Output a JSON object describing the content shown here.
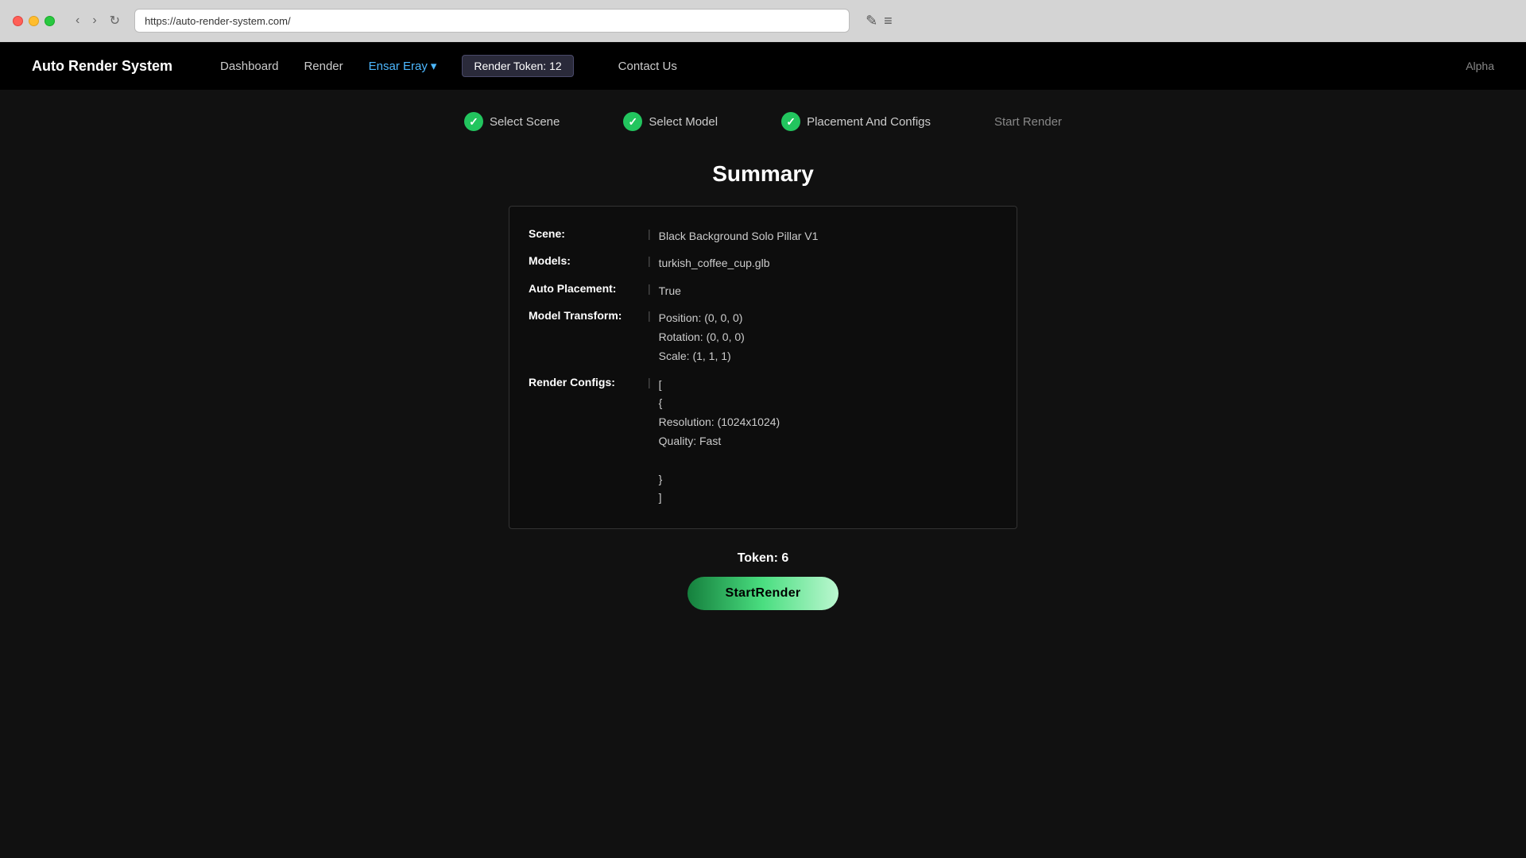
{
  "browser": {
    "url": "https://auto-render-system.com/",
    "traffic_lights": {
      "red_label": "close",
      "yellow_label": "minimize",
      "green_label": "maximize"
    }
  },
  "navbar": {
    "brand": "Auto Render System",
    "links": [
      {
        "label": "Dashboard",
        "href": "#"
      },
      {
        "label": "Render",
        "href": "#"
      }
    ],
    "user": {
      "name": "Ensar Eray",
      "has_dropdown": true
    },
    "token_badge": "Render Token: 12",
    "contact": "Contact Us",
    "alpha_text": "Alpha"
  },
  "steps": [
    {
      "id": "select-scene",
      "label": "Select Scene",
      "completed": true
    },
    {
      "id": "select-model",
      "label": "Select Model",
      "completed": true
    },
    {
      "id": "placement-configs",
      "label": "Placement And Configs",
      "completed": true
    },
    {
      "id": "start-render",
      "label": "Start Render",
      "completed": false,
      "active": true
    }
  ],
  "page": {
    "title": "Summary",
    "summary": {
      "rows": [
        {
          "label": "Scene:",
          "value": "Black Background Solo Pillar V1"
        },
        {
          "label": "Models:",
          "value": "turkish_coffee_cup.glb"
        },
        {
          "label": "Auto Placement:",
          "value": "True"
        },
        {
          "label": "Model Transform:",
          "value_lines": [
            "Position: (0, 0, 0)",
            "Rotation: (0, 0, 0)",
            "Scale: (1, 1, 1)"
          ]
        },
        {
          "label": "Render Configs:",
          "value_lines": [
            "[",
            "{",
            "Resolution: (1024x1024)",
            "Quality: Fast",
            "",
            "}",
            "]"
          ]
        }
      ]
    },
    "token_label": "Token: 6",
    "start_render_button": "StartRender"
  }
}
